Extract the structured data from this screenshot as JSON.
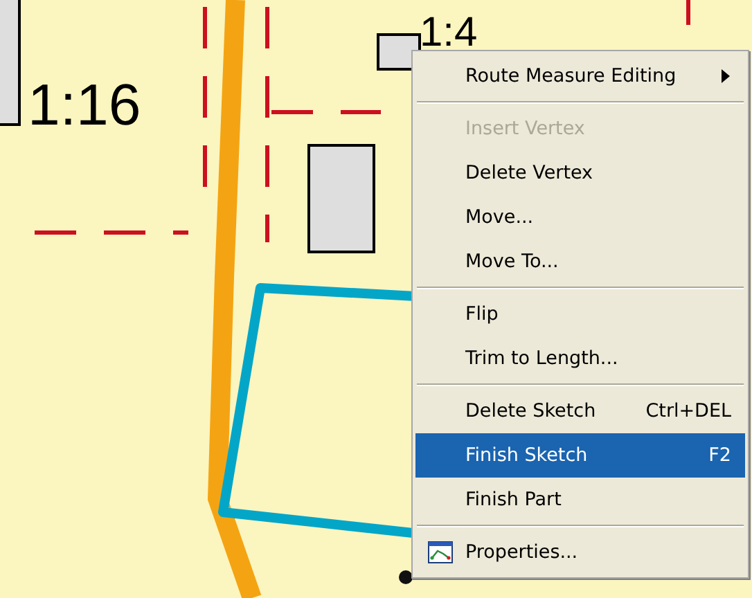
{
  "map": {
    "labels": [
      {
        "text": "1:16"
      },
      {
        "text": "1:4"
      }
    ]
  },
  "context_menu": {
    "items": [
      {
        "kind": "submenu",
        "label": "Route Measure Editing",
        "disabled": false,
        "selected": false
      },
      {
        "kind": "separator"
      },
      {
        "kind": "command",
        "label": "Insert Vertex",
        "disabled": true,
        "selected": false
      },
      {
        "kind": "command",
        "label": "Delete Vertex",
        "disabled": false,
        "selected": false
      },
      {
        "kind": "command",
        "label": "Move...",
        "disabled": false,
        "selected": false
      },
      {
        "kind": "command",
        "label": "Move To...",
        "disabled": false,
        "selected": false
      },
      {
        "kind": "separator"
      },
      {
        "kind": "command",
        "label": "Flip",
        "disabled": false,
        "selected": false
      },
      {
        "kind": "command",
        "label": "Trim to Length...",
        "disabled": false,
        "selected": false
      },
      {
        "kind": "separator"
      },
      {
        "kind": "command",
        "label": "Delete Sketch",
        "shortcut": "Ctrl+DEL",
        "disabled": false,
        "selected": false
      },
      {
        "kind": "command",
        "label": "Finish Sketch",
        "shortcut": "F2",
        "disabled": false,
        "selected": true
      },
      {
        "kind": "command",
        "label": "Finish Part",
        "disabled": false,
        "selected": false
      },
      {
        "kind": "separator"
      },
      {
        "kind": "with_icon",
        "label": "Properties...",
        "disabled": false,
        "selected": false
      }
    ]
  }
}
